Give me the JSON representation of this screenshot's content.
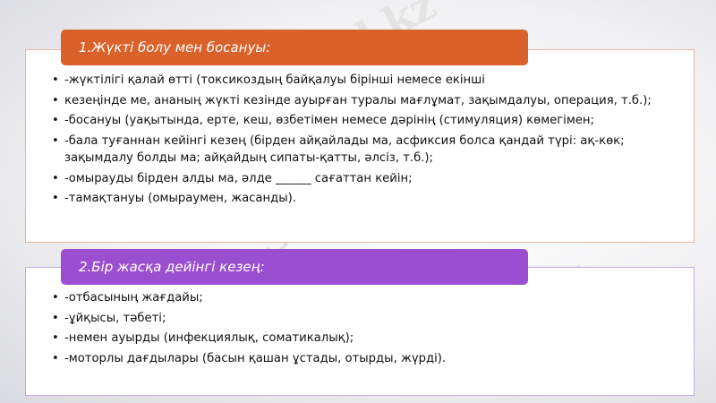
{
  "watermark": "Stud.kz",
  "section1": {
    "title": "1.Жүкті болу мен босануы:",
    "color": "#d9622b",
    "items": [
      "-жүктілігі қалай өтті (токсикоздың байқалуы бірінші  немесе екінші",
      "кезеңінде ме, ананың жүкті кезінде ауырған туралы мағлұмат, зақымдалуы, операция, т.б.);",
      "-босануы (уақытында, ерте, кеш, өзбетімен немесе дәрінің (стимуляция) көмегімен;",
      "-бала туғаннан кейінгі кезең (бірден айқайлады ма, асфиксия болса қандай түрі: ақ-көк; зақымдалу болды ма; айқайдың сипаты-қатты, әлсіз, т.б.);",
      "-омырауды бірден алды ма, әлде ______ сағаттан кейін;",
      "-тамақтануы (омыраумен, жасанды)."
    ]
  },
  "section2": {
    "title": "2.Бір жасқа дейінгі кезең:",
    "color": "#9b4fd0",
    "items": [
      "-отбасының жағдайы;",
      "-ұйқысы, тәбеті;",
      "-немен ауырды (инфекциялық, соматикалық);",
      "-моторлы дағдылары (басын қашан ұстады, отырды, жүрді)."
    ]
  }
}
